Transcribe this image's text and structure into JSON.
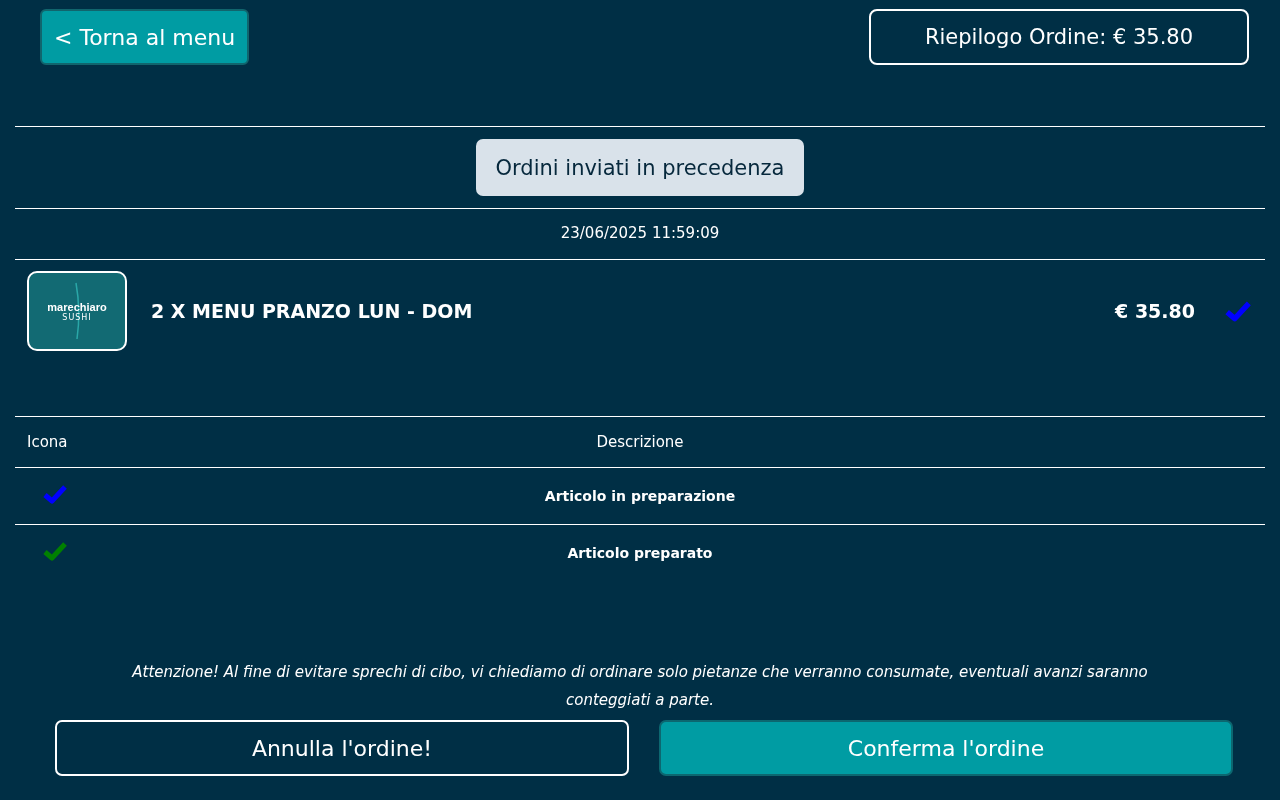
{
  "back_button": "< Torna al menu",
  "summary_button": "Riepilogo Ordine: € 35.80",
  "section_button": "Ordini inviati in precedenza",
  "order_time": "23/06/2025 11:59:09",
  "order_items": [
    {
      "logo": {
        "name": "marechiaro",
        "sub": "SUSHI"
      },
      "description": "2 X MENU PRANZO LUN - DOM",
      "price": "€ 35.80",
      "color": "#0000ff"
    }
  ],
  "legend": {
    "columns": [
      "Icona",
      "Descrizione"
    ],
    "rows": [
      {
        "color": "#0000ff",
        "label": "Articolo in preparazione"
      },
      {
        "color": "#008000",
        "label": "Articolo preparato"
      }
    ]
  },
  "notice": "Attenzione! Al fine di evitare sprechi di cibo, vi chiediamo di ordinare solo pietanze che verranno consumate, eventuali avanzi saranno conteggiati a parte.",
  "cancel_button": "Annulla l'ordine!",
  "confirm_button": "Conferma l'ordine"
}
